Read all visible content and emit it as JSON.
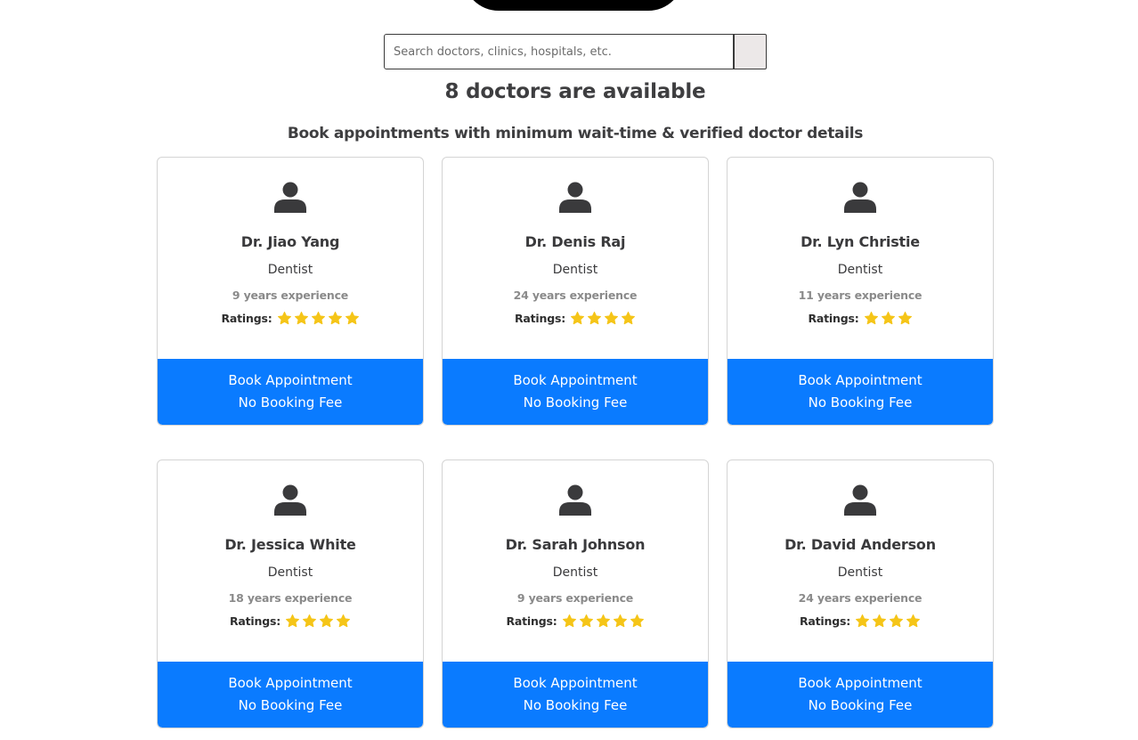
{
  "search": {
    "placeholder": "Search doctors, clinics, hospitals, etc."
  },
  "header": {
    "title": "8 doctors are available",
    "subtitle": "Book appointments with minimum wait-time & verified doctor details"
  },
  "doctors": [
    {
      "name": "Dr. Jiao Yang",
      "specialty": "Dentist",
      "experience": "9 years experience",
      "ratings_label": "Ratings:",
      "rating": 5,
      "button_line1": "Book Appointment",
      "button_line2": "No Booking Fee"
    },
    {
      "name": "Dr. Denis Raj",
      "specialty": "Dentist",
      "experience": "24 years experience",
      "ratings_label": "Ratings:",
      "rating": 4,
      "button_line1": "Book Appointment",
      "button_line2": "No Booking Fee"
    },
    {
      "name": "Dr. Lyn Christie",
      "specialty": "Dentist",
      "experience": "11 years experience",
      "ratings_label": "Ratings:",
      "rating": 3,
      "button_line1": "Book Appointment",
      "button_line2": "No Booking Fee"
    },
    {
      "name": "Dr. Jessica White",
      "specialty": "Dentist",
      "experience": "18 years experience",
      "ratings_label": "Ratings:",
      "rating": 4,
      "button_line1": "Book Appointment",
      "button_line2": "No Booking Fee"
    },
    {
      "name": "Dr. Sarah Johnson",
      "specialty": "Dentist",
      "experience": "9 years experience",
      "ratings_label": "Ratings:",
      "rating": 5,
      "button_line1": "Book Appointment",
      "button_line2": "No Booking Fee"
    },
    {
      "name": "Dr. David Anderson",
      "specialty": "Dentist",
      "experience": "24 years experience",
      "ratings_label": "Ratings:",
      "rating": 4,
      "button_line1": "Book Appointment",
      "button_line2": "No Booking Fee"
    }
  ],
  "colors": {
    "accent": "#0a7bff",
    "star": "#f5c518",
    "text": "#3a3a3c"
  },
  "icons": {
    "avatar": "user-avatar-icon",
    "rating": "star-icon",
    "search": "search-button"
  }
}
